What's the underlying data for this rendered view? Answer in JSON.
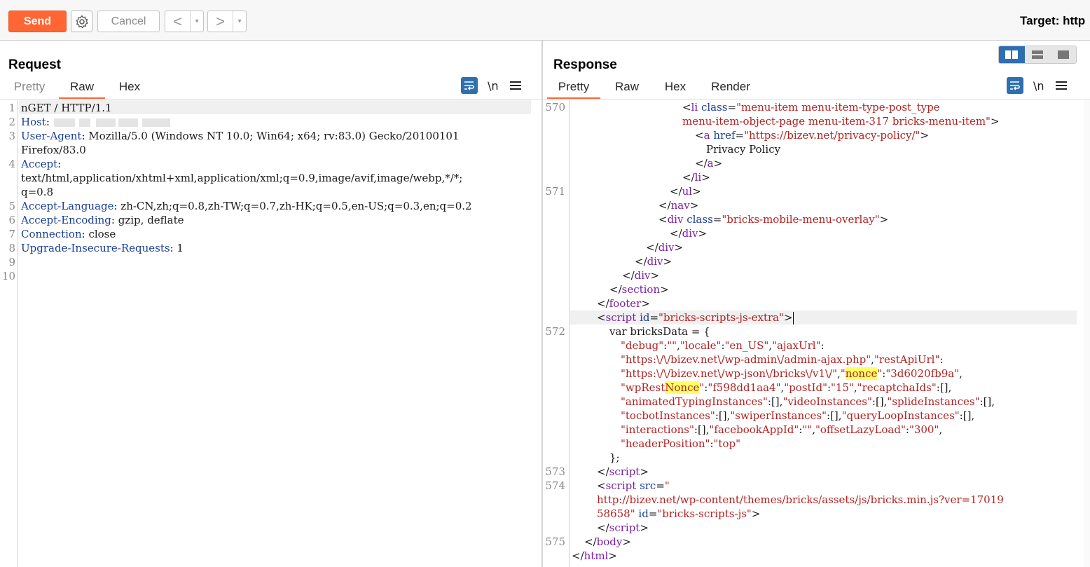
{
  "toolbar": {
    "send_label": "Send",
    "cancel_label": "Cancel",
    "back_glyph": "<",
    "forward_glyph": ">",
    "dropdown_glyph": "▾",
    "target_label": "Target: http"
  },
  "request": {
    "title": "Request",
    "tabs": [
      "Pretty",
      "Raw",
      "Hex"
    ],
    "active_tab": "Raw",
    "newline_toggle": "\\n"
  },
  "response": {
    "title": "Response",
    "tabs": [
      "Pretty",
      "Raw",
      "Hex",
      "Render"
    ],
    "active_tab": "Pretty",
    "newline_toggle": "\\n"
  },
  "colors": {
    "accent": "#ff6633",
    "tag": "#7b1fa2",
    "attr": "#1a3e96",
    "value": "#b22222",
    "highlight": "#ffff66",
    "toggle_active": "#2f6fb0"
  },
  "request_lines": [
    {
      "num": "1",
      "text": "nGET / HTTP/1.1"
    },
    {
      "num": "2",
      "name": "Host",
      "value": ""
    },
    {
      "num": "3",
      "name": "User-Agent",
      "value": " Mozilla/5.0 (Windows NT 10.0; Win64; x64; rv:83.0) Gecko/20100101"
    },
    {
      "num": "",
      "text": "Firefox/83.0"
    },
    {
      "num": "4",
      "name": "Accept",
      "value": ""
    },
    {
      "num": "",
      "text": "text/html,application/xhtml+xml,application/xml;q=0.9,image/avif,image/webp,*/*;"
    },
    {
      "num": "",
      "text": "q=0.8"
    },
    {
      "num": "5",
      "name": "Accept-Language",
      "value": " zh-CN,zh;q=0.8,zh-TW;q=0.7,zh-HK;q=0.5,en-US;q=0.3,en;q=0.2"
    },
    {
      "num": "6",
      "name": "Accept-Encoding",
      "value": " gzip, deflate"
    },
    {
      "num": "7",
      "name": "Connection",
      "value": " close"
    },
    {
      "num": "8",
      "name": "Upgrade-Insecure-Requests",
      "value": " 1"
    },
    {
      "num": "9",
      "text": ""
    },
    {
      "num": "10",
      "text": ""
    }
  ],
  "response_lines": [
    {
      "num": "570",
      "html": "<span class='k'>&lt;</span><span class='t'>li</span> <span class='a'>class</span>=<span class='v'>\"menu-item menu-item-type-post_type</span>"
    },
    {
      "num": "",
      "html": "<span class='v'>menu-item-object-page menu-item-317 bricks-menu-item\"</span>&gt;"
    },
    {
      "num": "",
      "html": "&lt;<span class='t'>a</span> <span class='a'>href</span>=<span class='v'>\"https://bizev.net/privacy-policy/\"</span>&gt;"
    },
    {
      "num": "",
      "html": "Privacy Policy"
    },
    {
      "num": "",
      "html": "&lt;/<span class='t'>a</span>&gt;"
    },
    {
      "num": "",
      "html": "&lt;/<span class='t'>li</span>&gt;"
    },
    {
      "num": "571",
      "html": "&lt;/<span class='t'>ul</span>&gt;"
    },
    {
      "num": "",
      "html": "&lt;/<span class='t'>nav</span>&gt;"
    },
    {
      "num": "",
      "html": "&lt;<span class='t'>div</span> <span class='a'>class</span>=<span class='v'>\"bricks-mobile-menu-overlay\"</span>&gt;"
    },
    {
      "num": "",
      "html": "&lt;/<span class='t'>div</span>&gt;"
    },
    {
      "num": "",
      "html": "&lt;/<span class='t'>div</span>&gt;"
    },
    {
      "num": "",
      "html": "&lt;/<span class='t'>div</span>&gt;"
    },
    {
      "num": "",
      "html": "&lt;/<span class='t'>div</span>&gt;"
    },
    {
      "num": "",
      "html": "&lt;/<span class='t'>section</span>&gt;"
    },
    {
      "num": "",
      "html": "&lt;/<span class='t'>footer</span>&gt;"
    },
    {
      "num": "",
      "html": "&lt;<span class='t'>script</span> <span class='a'>id</span>=<span class='v'>\"bricks-scripts-js-extra\"</span>&gt;<span class='caret'></span>"
    },
    {
      "num": "572",
      "html": "var bricksData = {"
    },
    {
      "num": "",
      "html": "<span class='v'>\"debug\"</span>:<span class='v'>\"\"</span>,<span class='v'>\"locale\"</span>:<span class='v'>\"en_US\"</span>,<span class='v'>\"ajaxUrl\"</span>:"
    },
    {
      "num": "",
      "html": "<span class='v'>\"https:\\/\\/bizev.net\\/wp-admin\\/admin-ajax.php\"</span>,<span class='v'>\"restApiUrl\"</span>:"
    },
    {
      "num": "",
      "html": "<span class='v'>\"https:\\/\\/bizev.net\\/wp-json\\/bricks\\/v1\\/\"</span>,<span class='v'>\"<span class='mark'>nonce</span>\"</span>:<span class='v'>\"3d6020fb9a\"</span>,"
    },
    {
      "num": "",
      "html": "<span class='v'>\"wpRest<span class='mark'>Nonce</span>\"</span>:<span class='v'>\"f598dd1aa4\"</span>,<span class='v'>\"postId\"</span>:<span class='v'>\"15\"</span>,<span class='v'>\"recaptchaIds\"</span>:[],"
    },
    {
      "num": "",
      "html": "<span class='v'>\"animatedTypingInstances\"</span>:[],<span class='v'>\"videoInstances\"</span>:[],<span class='v'>\"splideInstances\"</span>:[],"
    },
    {
      "num": "",
      "html": "<span class='v'>\"tocbotInstances\"</span>:[],<span class='v'>\"swiperInstances\"</span>:[],<span class='v'>\"queryLoopInstances\"</span>:[],"
    },
    {
      "num": "",
      "html": "<span class='v'>\"interactions\"</span>:[],<span class='v'>\"facebookAppId\"</span>:<span class='v'>\"\"</span>,<span class='v'>\"offsetLazyLoad\"</span>:<span class='v'>\"300\"</span>,"
    },
    {
      "num": "",
      "html": "<span class='v'>\"headerPosition\"</span>:<span class='v'>\"top\"</span>"
    },
    {
      "num": "",
      "html": "};"
    },
    {
      "num": "573",
      "html": "&lt;/<span class='t'>script</span>&gt;"
    },
    {
      "num": "574",
      "html": "&lt;<span class='t'>script</span> <span class='a'>src</span>=<span class='v'>\"</span>"
    },
    {
      "num": "",
      "html": "<span class='v'>http://bizev.net/wp-content/themes/bricks/assets/js/bricks.min.js?ver=17019</span>"
    },
    {
      "num": "",
      "html": "<span class='v'>58658\"</span> <span class='a'>id</span>=<span class='v'>\"bricks-scripts-js\"</span>&gt;"
    },
    {
      "num": "",
      "html": "&lt;/<span class='t'>script</span>&gt;"
    },
    {
      "num": "575",
      "html": "&lt;/<span class='t'>body</span>&gt;"
    },
    {
      "num": "",
      "html": "&lt;/<span class='t'>html</span>&gt;"
    }
  ]
}
